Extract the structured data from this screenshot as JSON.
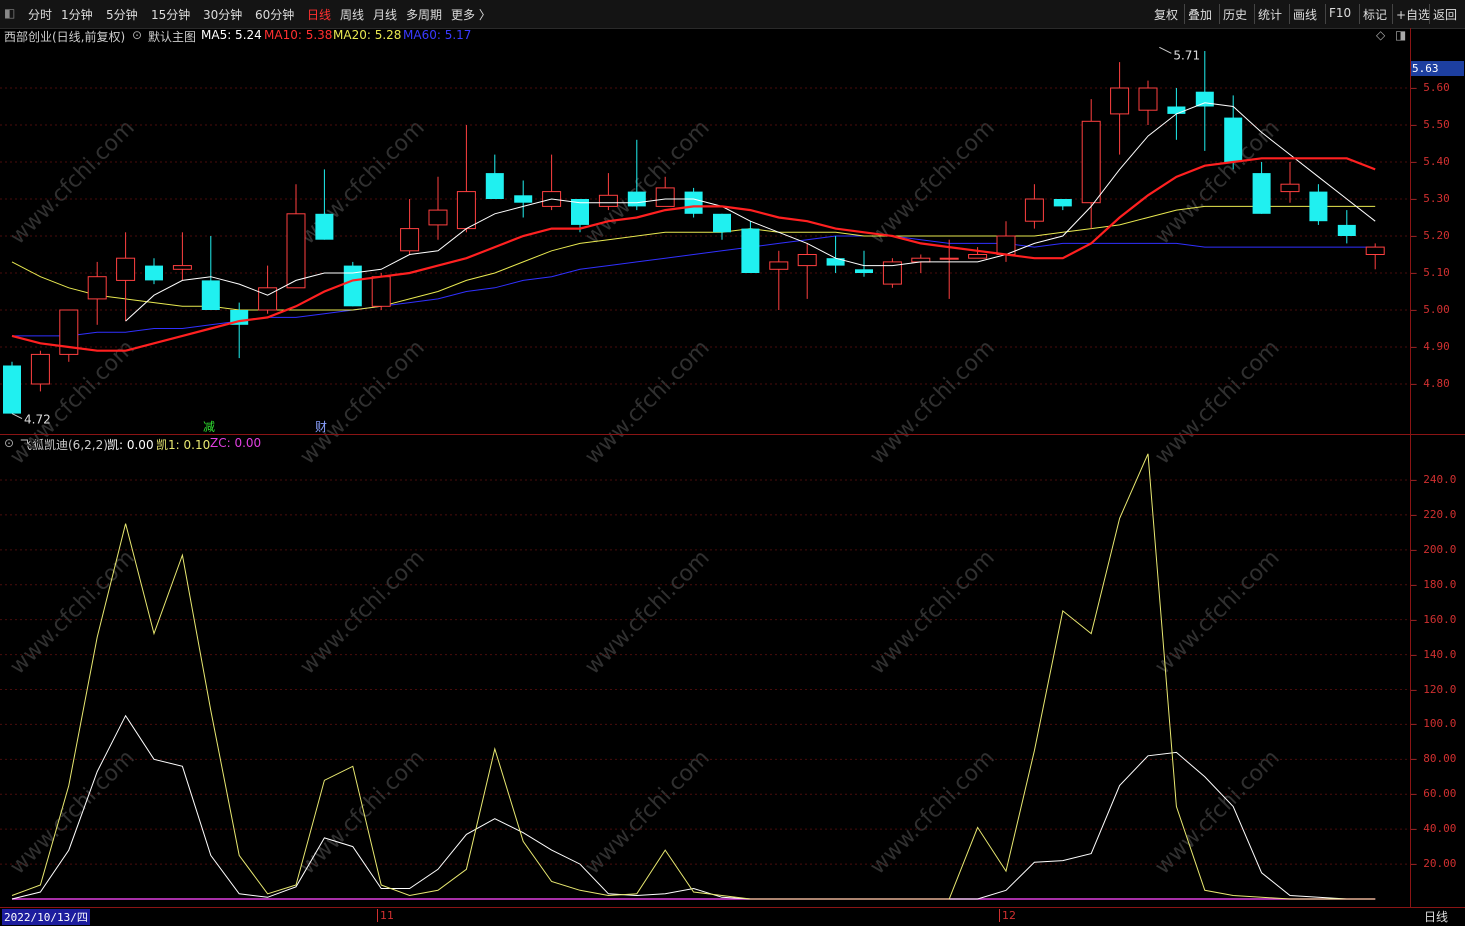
{
  "toolbar": {
    "periods": [
      "分时",
      "1分钟",
      "5分钟",
      "15分钟",
      "30分钟",
      "60分钟",
      "日线",
      "周线",
      "月线",
      "多周期",
      "更多 〉"
    ],
    "active_period": "日线",
    "tools": [
      "复权",
      "叠加",
      "历史",
      "统计",
      "画线",
      "F10",
      "标记",
      "+自选",
      "返回"
    ]
  },
  "main_legend": {
    "stock": "西部创业(日线,前复权)",
    "template": "默认主图",
    "ma5": "MA5: 5.24",
    "ma10": "MA10: 5.38",
    "ma20": "MA20: 5.28",
    "ma60": "MA60: 5.17",
    "colors": {
      "ma5": "#ffffff",
      "ma10": "#ff2020",
      "ma20": "#e8e850",
      "ma60": "#3030ff"
    }
  },
  "sub_legend": {
    "name": "飞狐凯迪(6,2,2)",
    "kai": "凯: 0.00",
    "kai1": "凯1: 0.10",
    "zc": "ZC: 0.00"
  },
  "current_price": "5.63",
  "annotations": {
    "high": "5.71",
    "low": "4.72",
    "event1": "减",
    "event2": "财"
  },
  "bottom": {
    "date": "2022/10/13/四",
    "month1": "11",
    "month2": "12",
    "period_label": "日线"
  },
  "watermark": "www.cfchi.com",
  "chart_data": [
    {
      "type": "candlestick",
      "y_ticks": [
        "5.60",
        "5.50",
        "5.40",
        "5.30",
        "5.20",
        "5.10",
        "5.00",
        "4.90",
        "4.80"
      ],
      "ylim": [
        4.72,
        5.71
      ],
      "candles": [
        [
          4.85,
          4.72,
          4.86,
          4.72
        ],
        [
          4.8,
          4.88,
          4.89,
          4.78
        ],
        [
          4.88,
          5.0,
          5.0,
          4.86
        ],
        [
          5.03,
          5.09,
          5.13,
          4.96
        ],
        [
          5.08,
          5.14,
          5.21,
          4.97
        ],
        [
          5.12,
          5.08,
          5.14,
          5.07
        ],
        [
          5.11,
          5.12,
          5.21,
          5.08
        ],
        [
          5.08,
          5.0,
          5.2,
          5.0
        ],
        [
          5.0,
          4.96,
          5.02,
          4.87
        ],
        [
          5.0,
          5.06,
          5.12,
          4.99
        ],
        [
          5.06,
          5.26,
          5.34,
          5.06
        ],
        [
          5.26,
          5.19,
          5.38,
          5.19
        ],
        [
          5.12,
          5.01,
          5.13,
          5.01
        ],
        [
          5.01,
          5.09,
          5.1,
          5.0
        ],
        [
          5.16,
          5.22,
          5.3,
          5.15
        ],
        [
          5.23,
          5.27,
          5.36,
          5.19
        ],
        [
          5.22,
          5.32,
          5.5,
          5.21
        ],
        [
          5.37,
          5.3,
          5.42,
          5.3
        ],
        [
          5.31,
          5.29,
          5.35,
          5.25
        ],
        [
          5.28,
          5.32,
          5.42,
          5.27
        ],
        [
          5.3,
          5.23,
          5.3,
          5.21
        ],
        [
          5.28,
          5.31,
          5.37,
          5.27
        ],
        [
          5.32,
          5.28,
          5.46,
          5.27
        ],
        [
          5.28,
          5.33,
          5.36,
          5.28
        ],
        [
          5.32,
          5.26,
          5.33,
          5.25
        ],
        [
          5.26,
          5.21,
          5.26,
          5.19
        ],
        [
          5.22,
          5.1,
          5.24,
          5.1
        ],
        [
          5.11,
          5.13,
          5.16,
          5.0
        ],
        [
          5.12,
          5.15,
          5.18,
          5.03
        ],
        [
          5.14,
          5.12,
          5.2,
          5.1
        ],
        [
          5.11,
          5.1,
          5.16,
          5.09
        ],
        [
          5.07,
          5.13,
          5.14,
          5.06
        ],
        [
          5.13,
          5.14,
          5.15,
          5.1
        ],
        [
          5.14,
          5.14,
          5.19,
          5.03
        ],
        [
          5.14,
          5.15,
          5.17,
          5.14
        ],
        [
          5.15,
          5.2,
          5.24,
          5.13
        ],
        [
          5.24,
          5.3,
          5.34,
          5.22
        ],
        [
          5.3,
          5.28,
          5.3,
          5.27
        ],
        [
          5.29,
          5.51,
          5.57,
          5.22
        ],
        [
          5.53,
          5.6,
          5.67,
          5.42
        ],
        [
          5.54,
          5.6,
          5.62,
          5.5
        ],
        [
          5.55,
          5.53,
          5.6,
          5.46
        ],
        [
          5.59,
          5.55,
          5.7,
          5.43
        ],
        [
          5.52,
          5.4,
          5.58,
          5.38
        ],
        [
          5.37,
          5.26,
          5.4,
          5.26
        ],
        [
          5.32,
          5.34,
          5.4,
          5.29
        ],
        [
          5.32,
          5.24,
          5.34,
          5.23
        ],
        [
          5.23,
          5.2,
          5.27,
          5.18
        ],
        [
          5.15,
          5.17,
          5.18,
          5.11
        ]
      ],
      "ma5": [
        null,
        null,
        null,
        null,
        4.97,
        5.04,
        5.08,
        5.09,
        5.07,
        5.04,
        5.08,
        5.1,
        5.1,
        5.11,
        5.15,
        5.16,
        5.22,
        5.26,
        5.28,
        5.3,
        5.29,
        5.29,
        5.29,
        5.3,
        5.3,
        5.28,
        5.24,
        5.21,
        5.18,
        5.14,
        5.12,
        5.12,
        5.13,
        5.13,
        5.13,
        5.15,
        5.18,
        5.2,
        5.28,
        5.38,
        5.47,
        5.53,
        5.56,
        5.55,
        5.48,
        5.42,
        5.36,
        5.3,
        5.24
      ],
      "ma10": [
        4.93,
        4.91,
        4.9,
        4.89,
        4.89,
        4.91,
        4.93,
        4.95,
        4.97,
        4.98,
        5.01,
        5.05,
        5.08,
        5.09,
        5.1,
        5.12,
        5.14,
        5.17,
        5.2,
        5.22,
        5.22,
        5.24,
        5.25,
        5.27,
        5.28,
        5.28,
        5.27,
        5.25,
        5.24,
        5.22,
        5.21,
        5.2,
        5.18,
        5.17,
        5.16,
        5.15,
        5.14,
        5.14,
        5.18,
        5.25,
        5.31,
        5.36,
        5.39,
        5.4,
        5.41,
        5.41,
        5.41,
        5.41,
        5.38
      ],
      "ma20": [
        5.13,
        5.09,
        5.06,
        5.04,
        5.03,
        5.02,
        5.01,
        5.01,
        5.0,
        5.0,
        5.0,
        5.0,
        5.0,
        5.01,
        5.03,
        5.05,
        5.08,
        5.1,
        5.13,
        5.16,
        5.18,
        5.19,
        5.2,
        5.21,
        5.21,
        5.21,
        5.22,
        5.21,
        5.21,
        5.21,
        5.2,
        5.2,
        5.2,
        5.2,
        5.2,
        5.2,
        5.2,
        5.21,
        5.22,
        5.23,
        5.25,
        5.27,
        5.28,
        5.28,
        5.28,
        5.28,
        5.28,
        5.28,
        5.28
      ],
      "ma60": [
        4.93,
        4.93,
        4.93,
        4.94,
        4.94,
        4.95,
        4.95,
        4.96,
        4.97,
        4.98,
        4.98,
        4.99,
        5.0,
        5.01,
        5.02,
        5.03,
        5.05,
        5.06,
        5.08,
        5.09,
        5.11,
        5.12,
        5.13,
        5.14,
        5.15,
        5.16,
        5.17,
        5.18,
        5.19,
        5.2,
        5.2,
        5.2,
        5.19,
        5.18,
        5.18,
        5.18,
        5.17,
        5.18,
        5.18,
        5.18,
        5.18,
        5.18,
        5.17,
        5.17,
        5.17,
        5.17,
        5.17,
        5.17,
        5.17
      ]
    },
    {
      "type": "line",
      "y_ticks": [
        "240.0",
        "220.0",
        "200.0",
        "180.0",
        "160.0",
        "140.0",
        "120.0",
        "100.0",
        "80.00",
        "60.00",
        "40.00",
        "20.00"
      ],
      "ylim": [
        0,
        250
      ],
      "series": [
        {
          "name": "凯1",
          "color": "#e8e870",
          "values": [
            2,
            8,
            65,
            150,
            215,
            152,
            197,
            108,
            25,
            3,
            8,
            68,
            76,
            8,
            2,
            5,
            17,
            86,
            33,
            10,
            5,
            2,
            3,
            28,
            4,
            2,
            0,
            0,
            0,
            0,
            0,
            0,
            0,
            0,
            41,
            16,
            85,
            165,
            152,
            218,
            255,
            53,
            5,
            2,
            1,
            0,
            0,
            0,
            0
          ]
        },
        {
          "name": "凯",
          "color": "#ffffff",
          "values": [
            0,
            4,
            28,
            73,
            105,
            80,
            76,
            25,
            3,
            1,
            7,
            35,
            30,
            6,
            6,
            17,
            37,
            46,
            38,
            28,
            20,
            3,
            2,
            3,
            6,
            1,
            0,
            0,
            0,
            0,
            0,
            0,
            0,
            0,
            0,
            5,
            21,
            22,
            26,
            65,
            82,
            84,
            70,
            53,
            15,
            2,
            1,
            0,
            0
          ]
        },
        {
          "name": "ZC",
          "color": "#e040e0",
          "values": [
            0,
            0,
            0,
            0,
            0,
            0,
            0,
            0,
            0,
            0,
            0,
            0,
            0,
            0,
            0,
            0,
            0,
            0,
            0,
            0,
            0,
            0,
            0,
            0,
            0,
            0,
            0,
            0,
            0,
            0,
            0,
            0,
            0,
            0,
            0,
            0,
            0,
            0,
            0,
            0,
            0,
            0,
            0,
            0,
            0,
            0,
            0,
            0,
            0
          ]
        }
      ]
    }
  ]
}
